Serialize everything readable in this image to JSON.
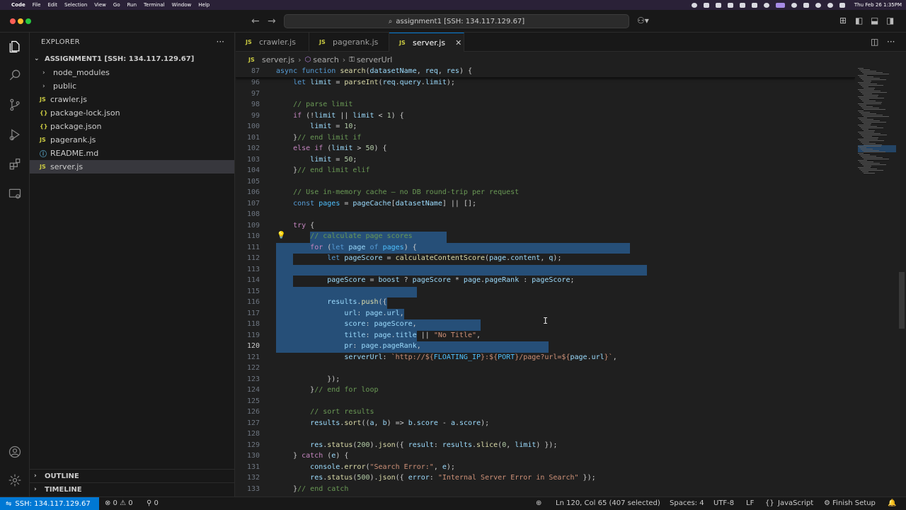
{
  "menubar": {
    "app": "Code",
    "items": [
      "File",
      "Edit",
      "Selection",
      "View",
      "Go",
      "Run",
      "Terminal",
      "Window",
      "Help"
    ],
    "clock": "Thu Feb 26  1:35PM"
  },
  "titlebar": {
    "search_text": "assignment1 [SSH: 134.117.129.67]"
  },
  "sidebar": {
    "header": "EXPLORER",
    "more": "···",
    "root": "ASSIGNMENT1 [SSH: 134.117.129.67]",
    "items": [
      {
        "label": "node_modules",
        "icon": "›"
      },
      {
        "label": "public",
        "icon": "›"
      },
      {
        "label": "crawler.js",
        "icon": "JS"
      },
      {
        "label": "package-lock.json",
        "icon": "{}"
      },
      {
        "label": "package.json",
        "icon": "{}"
      },
      {
        "label": "pagerank.js",
        "icon": "JS"
      },
      {
        "label": "README.md",
        "icon": "ⓘ"
      },
      {
        "label": "server.js",
        "icon": "JS"
      }
    ],
    "outline": "OUTLINE",
    "timeline": "TIMELINE"
  },
  "tabs": [
    {
      "label": "crawler.js",
      "icon": "JS"
    },
    {
      "label": "pagerank.js",
      "icon": "JS"
    },
    {
      "label": "server.js",
      "icon": "JS"
    }
  ],
  "breadcrumb": {
    "file": "server.js",
    "fn": "search",
    "key": "serverUrl"
  },
  "editor": {
    "sticky_line_number": "87",
    "line_numbers": [
      "96",
      "97",
      "98",
      "99",
      "100",
      "101",
      "102",
      "103",
      "104",
      "105",
      "106",
      "107",
      "108",
      "109",
      "110",
      "111",
      "112",
      "113",
      "114",
      "115",
      "116",
      "117",
      "118",
      "119",
      "120",
      "121",
      "122",
      "123",
      "124",
      "125",
      "126",
      "127",
      "128",
      "129",
      "130",
      "131",
      "132",
      "133"
    ]
  },
  "statusbar": {
    "remote": "SSH: 134.117.129.67",
    "problems": "⊗ 0 ⚠ 0",
    "ports": "⚲ 0",
    "position": "Ln 120, Col 65 (407 selected)",
    "spaces": "Spaces: 4",
    "encoding": "UTF-8",
    "eol": "LF",
    "language": "JavaScript",
    "finish_setup": "Finish Setup"
  },
  "colors": {
    "accent": "#0078d4",
    "selection": "#264f78",
    "background": "#1f1f1f"
  }
}
